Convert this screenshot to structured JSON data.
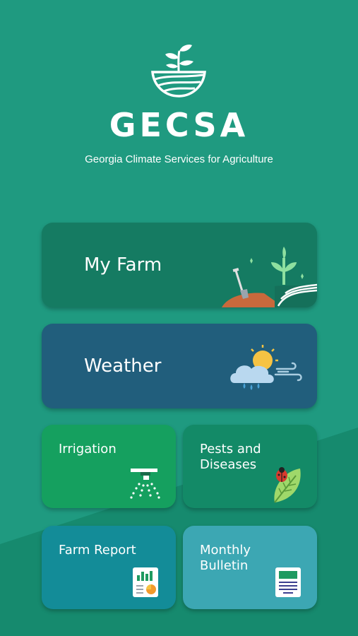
{
  "app": {
    "name": "GECSA",
    "subtitle": "Georgia Climate Services for Agriculture"
  },
  "cards": {
    "my_farm": {
      "label": "My Farm",
      "icon": "plant-shovel-icon"
    },
    "weather": {
      "label": "Weather",
      "icon": "sun-cloud-rain-icon"
    },
    "irrigation": {
      "label": "Irrigation",
      "icon": "sprinkler-icon"
    },
    "pests": {
      "label": "Pests and\nDiseases",
      "icon": "ladybug-leaf-icon"
    },
    "farm_report": {
      "label": "Farm Report",
      "icon": "report-chart-icon"
    },
    "bulletin": {
      "label": "Monthly\nBulletin",
      "icon": "bulletin-document-icon"
    }
  },
  "colors": {
    "background": "#1f9a80",
    "background_lower": "#168a6e",
    "my_farm": "#157b62",
    "weather": "#215e7c",
    "irrigation": "#15a05f",
    "pests": "#138a67",
    "farm_report": "#138c98",
    "bulletin": "#3ca7b3"
  }
}
